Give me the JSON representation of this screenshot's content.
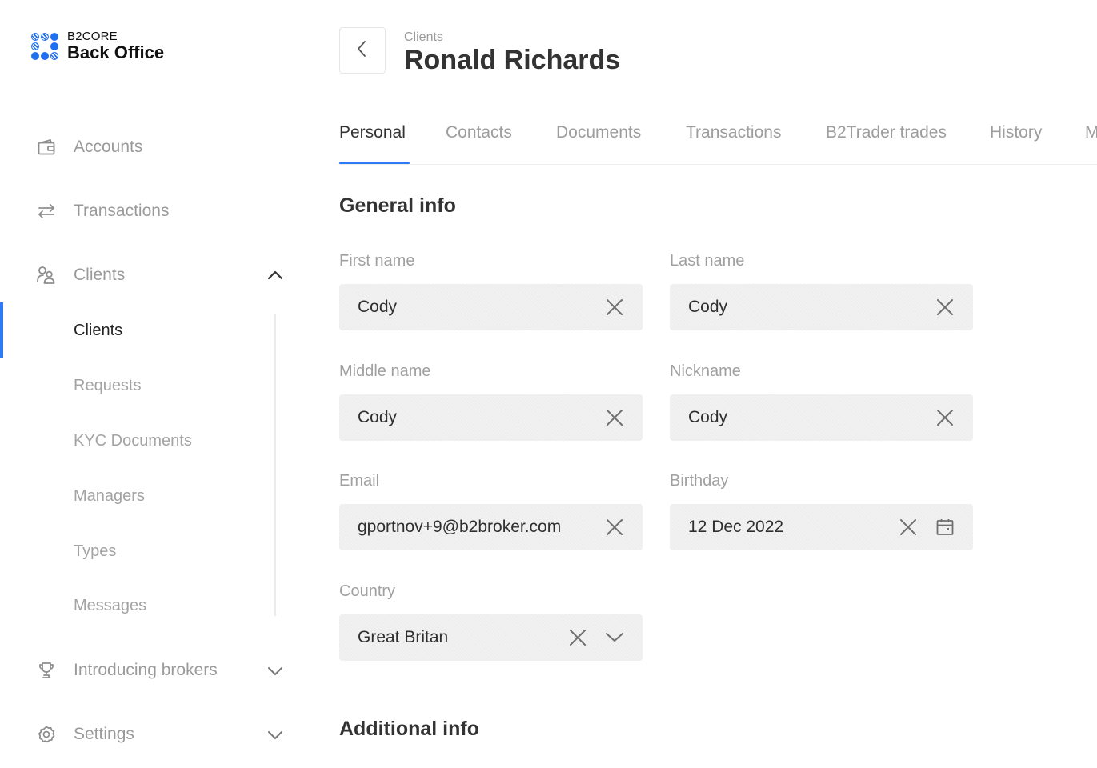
{
  "brand": {
    "top": "B2CORE",
    "bottom": "Back Office"
  },
  "sidebar": {
    "items": [
      {
        "label": "Accounts",
        "icon": "wallet-icon"
      },
      {
        "label": "Transactions",
        "icon": "transfer-arrows-icon"
      },
      {
        "label": "Clients",
        "icon": "clients-icon",
        "expanded": true
      },
      {
        "label": "Introducing brokers",
        "icon": "trophy-icon",
        "expanded": false
      },
      {
        "label": "Settings",
        "icon": "gear-icon",
        "expanded": false
      }
    ],
    "clients_sub": [
      {
        "label": "Clients",
        "active": true
      },
      {
        "label": "Requests"
      },
      {
        "label": "KYC Documents"
      },
      {
        "label": "Managers"
      },
      {
        "label": "Types"
      },
      {
        "label": "Messages"
      }
    ]
  },
  "header": {
    "breadcrumb": "Clients",
    "title": "Ronald Richards"
  },
  "tabs": [
    "Personal",
    "Contacts",
    "Documents",
    "Transactions",
    "B2Trader trades",
    "History",
    "M"
  ],
  "active_tab": "Personal",
  "general_info": {
    "title": "General info",
    "first_name": {
      "label": "First name",
      "value": "Cody"
    },
    "last_name": {
      "label": "Last name",
      "value": "Cody"
    },
    "middle_name": {
      "label": "Middle name",
      "value": "Cody"
    },
    "nickname": {
      "label": "Nickname",
      "value": "Cody"
    },
    "email": {
      "label": "Email",
      "value": "gportnov+9@b2broker.com"
    },
    "birthday": {
      "label": "Birthday",
      "value": "12 Dec 2022"
    },
    "country": {
      "label": "Country",
      "value": "Great Britan"
    }
  },
  "additional_info": {
    "title": "Additional info"
  },
  "colors": {
    "accent": "#2f7bf5",
    "brand": "#1f6ff2",
    "field_bg": "#f1f1f1",
    "muted_text": "#9d9d9d"
  }
}
